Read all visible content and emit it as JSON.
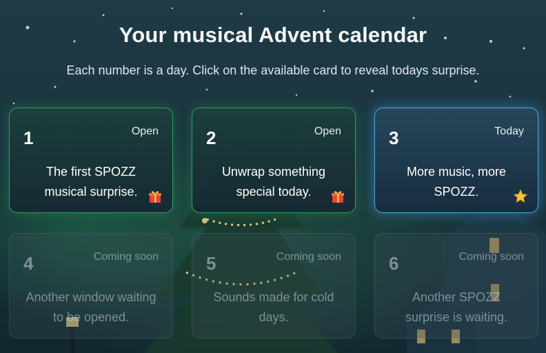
{
  "header": {
    "title": "Your musical Advent calendar",
    "subtitle": "Each number is a day. Click on the available card to reveal todays surprise."
  },
  "cards": [
    {
      "day": "1",
      "status": "Open",
      "text": "The first SPOZZ musical surprise.",
      "state": "open",
      "icon": "gift-icon"
    },
    {
      "day": "2",
      "status": "Open",
      "text": "Unwrap something special today.",
      "state": "open",
      "icon": "gift-icon"
    },
    {
      "day": "3",
      "status": "Today",
      "text": "More music, more SPOZZ.",
      "state": "today",
      "icon": "star-icon"
    },
    {
      "day": "4",
      "status": "Coming soon",
      "text": "Another window waiting to be opened.",
      "state": "locked"
    },
    {
      "day": "5",
      "status": "Coming soon",
      "text": "Sounds made for cold days.",
      "state": "locked"
    },
    {
      "day": "6",
      "status": "Coming soon",
      "text": "Another SPOZZ surprise is waiting.",
      "state": "locked"
    }
  ],
  "colors": {
    "open_border": "#2fa25c",
    "today_border": "#4aa8e0",
    "background": "#1b3540"
  }
}
